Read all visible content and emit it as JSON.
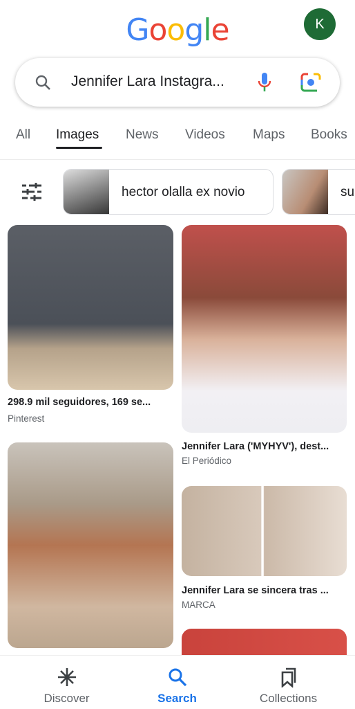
{
  "logo": {
    "text": "Google",
    "colors": [
      "#4285F4",
      "#EA4335",
      "#FBBC05",
      "#4285F4",
      "#34A853",
      "#EA4335"
    ]
  },
  "account": {
    "initial": "K",
    "color": "#1e6b35"
  },
  "search": {
    "query": "Jennifer Lara Instagra...",
    "icons": [
      "search-icon",
      "microphone-icon",
      "lens-camera-icon"
    ]
  },
  "tabs": [
    {
      "label": "All"
    },
    {
      "label": "Images",
      "active": true
    },
    {
      "label": "News"
    },
    {
      "label": "Videos"
    },
    {
      "label": "Maps"
    },
    {
      "label": "Books"
    }
  ],
  "chips": [
    {
      "label": "hector olalla ex novio"
    },
    {
      "label": "su"
    }
  ],
  "results": [
    {
      "caption": "298.9 mil seguidores, 169 se...",
      "source": "Pinterest"
    },
    {
      "caption": "Jennifer Lara ('MYHYV'), dest...",
      "source": "El Periódico"
    },
    {
      "caption": "Jennifer Lara se sincera tras ...",
      "source": "MARCA"
    }
  ],
  "nav": [
    {
      "label": "Discover",
      "icon": "asterisk-icon"
    },
    {
      "label": "Search",
      "icon": "search-icon",
      "active": true
    },
    {
      "label": "Collections",
      "icon": "collections-icon"
    }
  ],
  "accent": "#1a73e8"
}
